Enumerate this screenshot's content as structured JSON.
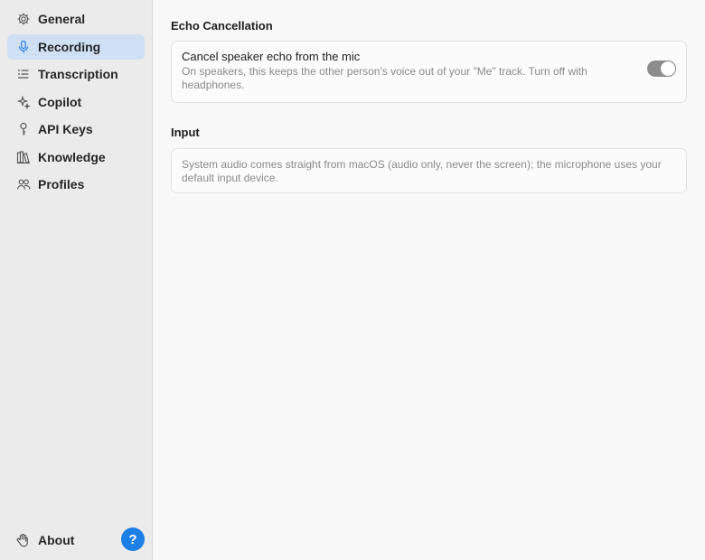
{
  "sidebar": {
    "items": [
      {
        "label": "General",
        "icon": "gear-icon",
        "active": false
      },
      {
        "label": "Recording",
        "icon": "microphone-icon",
        "active": true
      },
      {
        "label": "Transcription",
        "icon": "transcript-lines-icon",
        "active": false
      },
      {
        "label": "Copilot",
        "icon": "sparkle-icon",
        "active": false
      },
      {
        "label": "API Keys",
        "icon": "key-icon",
        "active": false
      },
      {
        "label": "Knowledge",
        "icon": "books-icon",
        "active": false
      },
      {
        "label": "Profiles",
        "icon": "people-icon",
        "active": false
      }
    ],
    "about_label": "About",
    "help_label": "?"
  },
  "echo": {
    "section_title": "Echo Cancellation",
    "toggle_title": "Cancel speaker echo from the mic",
    "toggle_desc": "On speakers, this keeps the other person's voice out of your \"Me\" track. Turn off with headphones.",
    "toggle_on": true
  },
  "input": {
    "section_title": "Input",
    "desc": "System audio comes straight from macOS (audio only, never the screen); the microphone uses your default input device."
  },
  "colors": {
    "accent": "#1c7fe6",
    "active_item_bg": "#cfe0f4",
    "toggle_bg": "#8c8c8c"
  }
}
